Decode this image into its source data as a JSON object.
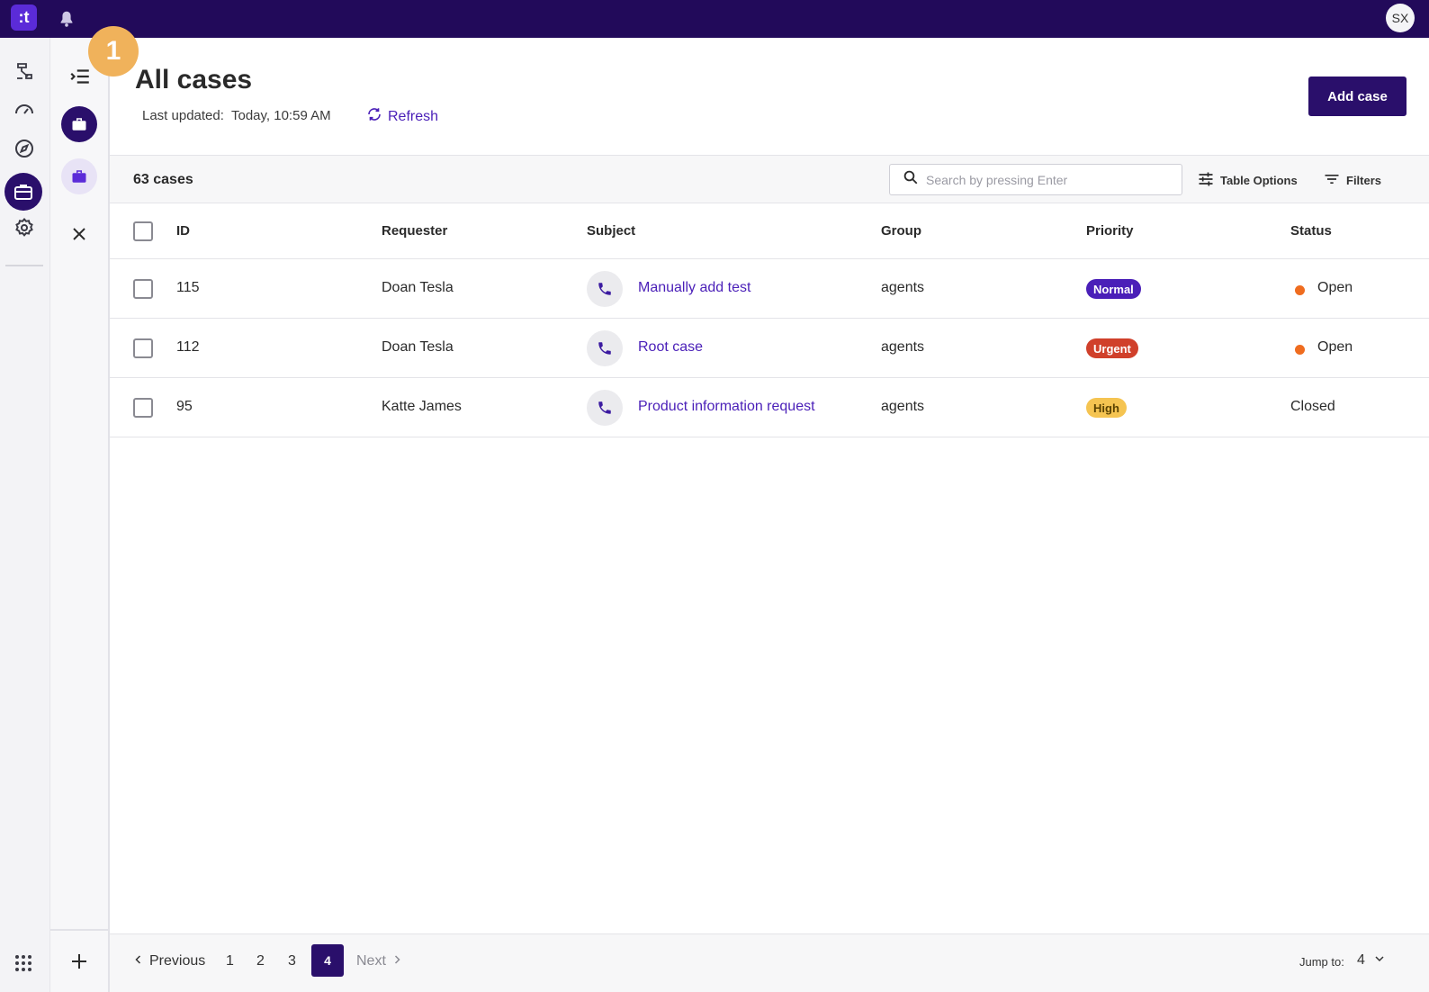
{
  "topbar": {
    "logo_text": ":t",
    "avatar_initials": "SX"
  },
  "panel2": {
    "badge_number": "1"
  },
  "header": {
    "title": "All cases",
    "last_updated_label": "Last updated:",
    "last_updated_value": "Today, 10:59 AM",
    "refresh_label": "Refresh",
    "add_case_label": "Add case"
  },
  "toolbar": {
    "count": "63 cases",
    "search_placeholder": "Search by pressing Enter",
    "table_options_label": "Table Options",
    "filters_label": "Filters"
  },
  "table": {
    "columns": [
      "ID",
      "Requester",
      "Subject",
      "Group",
      "Priority",
      "Status"
    ],
    "rows": [
      {
        "id": "115",
        "requester": "Doan Tesla",
        "subject": "Manually add test",
        "group": "agents",
        "priority": "Normal",
        "status": "Open"
      },
      {
        "id": "112",
        "requester": "Doan Tesla",
        "subject": "Root case",
        "group": "agents",
        "priority": "Urgent",
        "status": "Open"
      },
      {
        "id": "95",
        "requester": "Katte James",
        "subject": "Product information request",
        "group": "agents",
        "priority": "High",
        "status": "Closed"
      }
    ]
  },
  "pagination": {
    "previous_label": "Previous",
    "pages": [
      "1",
      "2",
      "3",
      "4"
    ],
    "current_page": "4",
    "next_label": "Next",
    "jump_label": "Jump to:",
    "jump_value": "4"
  },
  "colors": {
    "brand": "#2a0f6b",
    "accent_link": "#4a1fb8",
    "priority_normal": "#4a1fb8",
    "priority_urgent": "#d0402b",
    "priority_high": "#f5c451",
    "status_open_dot": "#ef6c1f"
  },
  "icons": [
    "bell-icon",
    "workflow-icon",
    "dashboard-icon",
    "compass-icon",
    "briefcase-icon",
    "gear-icon",
    "apps-grid-icon",
    "menu-collapse-icon",
    "close-icon",
    "plus-icon",
    "refresh-icon",
    "search-icon",
    "table-options-icon",
    "filter-icon",
    "phone-icon",
    "chevron-left-icon",
    "chevron-right-icon",
    "chevron-down-icon"
  ]
}
